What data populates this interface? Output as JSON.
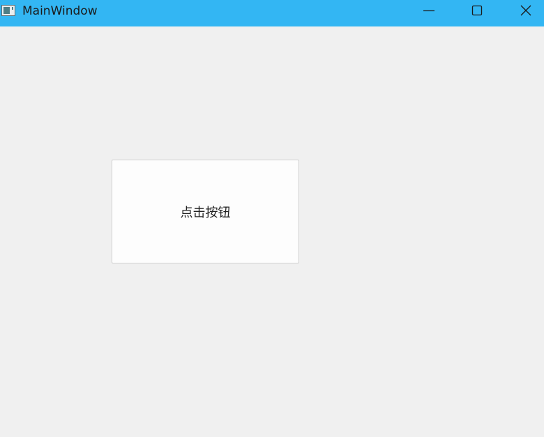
{
  "window": {
    "title": "MainWindow",
    "titlebar_color": "#33b6f3",
    "background_color": "#f0f0f0",
    "icons": {
      "app": "app-window-icon",
      "minimize": "minimize-icon",
      "maximize": "maximize-icon",
      "close": "close-icon"
    }
  },
  "main": {
    "button_label": "点击按钮"
  }
}
